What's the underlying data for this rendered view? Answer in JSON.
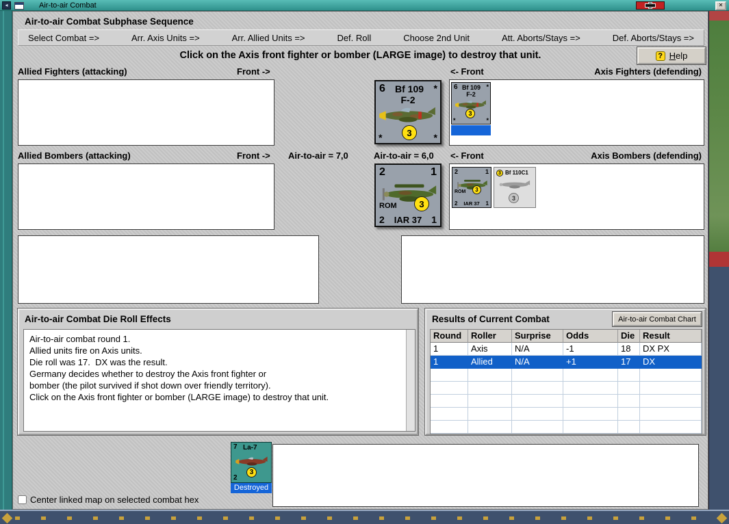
{
  "window": {
    "title": "Air-to-air Combat",
    "close_glyph": "✕"
  },
  "header": {
    "sequence_title": "Air-to-air Combat Subphase Sequence",
    "steps": [
      "Select Combat =>",
      "Arr. Axis Units =>",
      "Arr. Allied Units =>",
      "Def. Roll",
      "Choose 2nd Unit",
      "Att. Aborts/Stays =>",
      "Def. Aborts/Stays =>"
    ],
    "instruction": "Click on the Axis front fighter or bomber (LARGE image) to destroy that unit.",
    "help_label": "Help",
    "help_icon": "?"
  },
  "labels": {
    "allied_fighters": "Allied Fighters (attacking)",
    "front_arrow_right": "Front ->",
    "front_arrow_left": "<- Front",
    "axis_fighters": "Axis Fighters (defending)",
    "allied_bombers": "Allied Bombers (attacking)",
    "allied_air": "Air-to-air = 7,0",
    "axis_air": "Air-to-air = 6,0",
    "axis_bombers": "Axis Bombers (defending)",
    "checkbox": "Center linked map on selected combat hex"
  },
  "units": {
    "axis_fighter": {
      "top_left": "6",
      "name_line1": "Bf 109",
      "name_line2": "F-2",
      "asterisk": "*",
      "strength": "3"
    },
    "axis_bomber": {
      "top_left": "2",
      "top_right": "1",
      "nation": "ROM",
      "type": "IAR 37",
      "bottom_left": "2",
      "bottom_right": "1",
      "strength": "3"
    },
    "bf110": {
      "name": "Bf 110C1",
      "top_badge": "3",
      "strength": "3"
    },
    "la7": {
      "top_left": "7",
      "name": "La-7",
      "bottom_left": "2",
      "strength": "3",
      "status": "Destroyed"
    }
  },
  "die_panel": {
    "title": "Air-to-air Combat Die Roll Effects",
    "lines": [
      "Air-to-air combat round 1.",
      "Allied units fire on Axis units.",
      "Die roll was 17.  DX was the result.",
      "Germany decides whether to destroy the Axis front fighter or",
      "bomber (the pilot survived if shot down over friendly territory).",
      "Click on the Axis front fighter or bomber (LARGE image) to destroy that unit."
    ]
  },
  "results": {
    "title": "Results of Current Combat",
    "chart_button": "Air-to-air Combat Chart",
    "columns": [
      "Round",
      "Roller",
      "Surprise",
      "Odds",
      "Die",
      "Result"
    ],
    "rows": [
      [
        "1",
        "Axis",
        "N/A",
        "-1",
        "18",
        "DX PX"
      ],
      [
        "1",
        "Allied",
        "N/A",
        "+1",
        "17",
        "DX"
      ]
    ]
  }
}
